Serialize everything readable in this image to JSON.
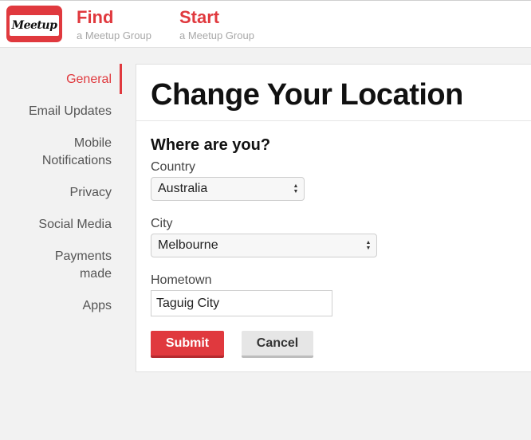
{
  "header": {
    "logo_text": "Meetup",
    "find": {
      "title": "Find",
      "subtitle": "a Meetup Group"
    },
    "start": {
      "title": "Start",
      "subtitle": "a Meetup Group"
    }
  },
  "sidebar": {
    "items": [
      {
        "label": "General",
        "active": true
      },
      {
        "label": "Email Updates"
      },
      {
        "label": "Mobile Notifications"
      },
      {
        "label": "Privacy"
      },
      {
        "label": "Social Media"
      },
      {
        "label": "Payments made"
      },
      {
        "label": "Apps"
      }
    ]
  },
  "main": {
    "title": "Change Your Location",
    "section_title": "Where are you?",
    "country": {
      "label": "Country",
      "value": "Australia"
    },
    "city": {
      "label": "City",
      "value": "Melbourne"
    },
    "hometown": {
      "label": "Hometown",
      "value": "Taguig City"
    },
    "submit_label": "Submit",
    "cancel_label": "Cancel"
  },
  "colors": {
    "accent": "#e0393e",
    "background": "#f2f2f2"
  }
}
